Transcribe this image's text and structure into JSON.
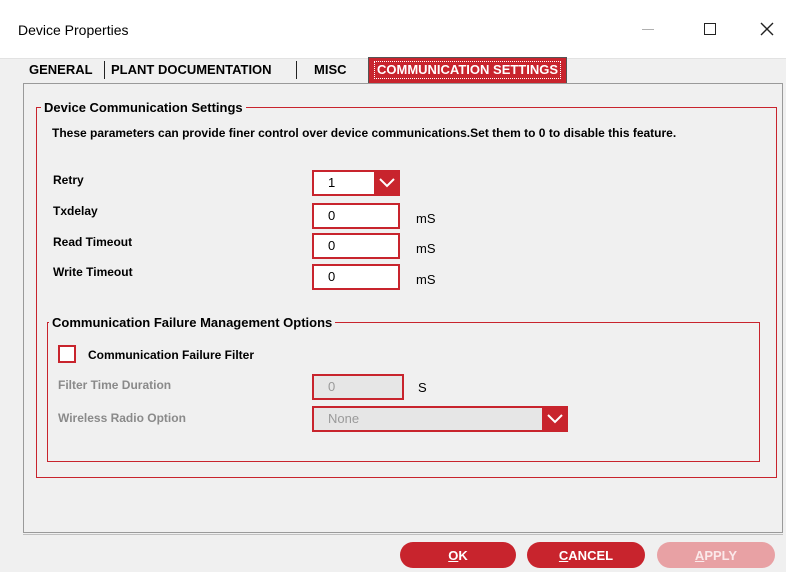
{
  "window": {
    "title": "Device Properties"
  },
  "tabs": [
    {
      "label": "GENERAL"
    },
    {
      "label": "PLANT DOCUMENTATION"
    },
    {
      "label": "MISC"
    },
    {
      "label": "COMMUNICATION SETTINGS",
      "active": true
    }
  ],
  "comm_group": {
    "title": "Device Communication Settings",
    "description": "These parameters can provide finer control over device communications.Set them to 0 to disable this feature.",
    "retry": {
      "label": "Retry",
      "value": "1"
    },
    "txdelay": {
      "label": "Txdelay",
      "value": "0",
      "unit": "mS"
    },
    "read_timeout": {
      "label": "Read Timeout",
      "value": "0",
      "unit": "mS"
    },
    "write_timeout": {
      "label": "Write Timeout",
      "value": "0",
      "unit": "mS"
    }
  },
  "failure_group": {
    "title": "Communication Failure Management Options",
    "filter_checkbox": {
      "label": "Communication Failure Filter",
      "checked": false
    },
    "filter_time": {
      "label": "Filter Time Duration",
      "value": "0",
      "unit": "S",
      "disabled": true
    },
    "wireless_option": {
      "label": "Wireless Radio Option",
      "value": "None",
      "disabled": true
    }
  },
  "buttons": {
    "ok": {
      "label": "OK",
      "underline": "O",
      "rest": "K"
    },
    "cancel": {
      "label": "CANCEL",
      "underline": "C",
      "rest": "ANCEL"
    },
    "apply": {
      "label": "APPLY",
      "underline": "A",
      "rest": "PPLY",
      "disabled": true
    }
  },
  "colors": {
    "accent": "#c8242d",
    "accent_disabled": "#e8a1a4"
  }
}
